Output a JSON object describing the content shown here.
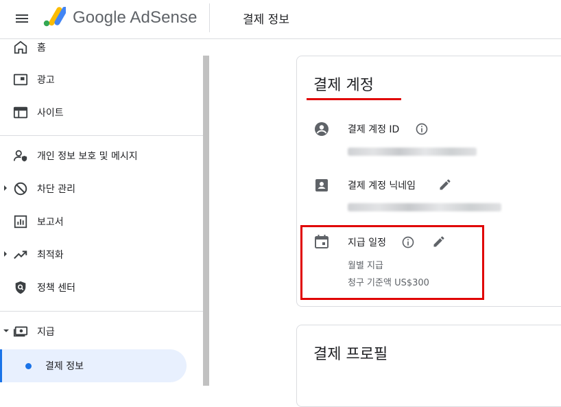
{
  "header": {
    "brand": "Google AdSense",
    "page_title": "결제 정보"
  },
  "sidebar": {
    "items": [
      {
        "label": "홈",
        "icon": "home-icon"
      },
      {
        "label": "광고",
        "icon": "ads-icon"
      },
      {
        "label": "사이트",
        "icon": "sites-icon"
      },
      {
        "label": "개인 정보 보호 및 메시지",
        "icon": "privacy-messaging-icon"
      },
      {
        "label": "차단 관리",
        "icon": "block-icon"
      },
      {
        "label": "보고서",
        "icon": "reports-icon"
      },
      {
        "label": "최적화",
        "icon": "trending-up-icon"
      },
      {
        "label": "정책 센터",
        "icon": "shield-search-icon"
      },
      {
        "label": "지급",
        "icon": "payments-icon"
      }
    ],
    "sub_active": "결제 정보"
  },
  "billing_account": {
    "title": "결제 계정",
    "id_label": "결제 계정 ID",
    "nickname_label": "결제 계정 닉네임",
    "schedule_label": "지급 일정",
    "schedule_frequency": "월별 지급",
    "schedule_threshold": "청구 기준액 US$300"
  },
  "billing_profile": {
    "title": "결제 프로필"
  },
  "colors": {
    "accent": "#1a73e8",
    "active_bg": "#e8f0fe",
    "highlight": "#e00000"
  }
}
